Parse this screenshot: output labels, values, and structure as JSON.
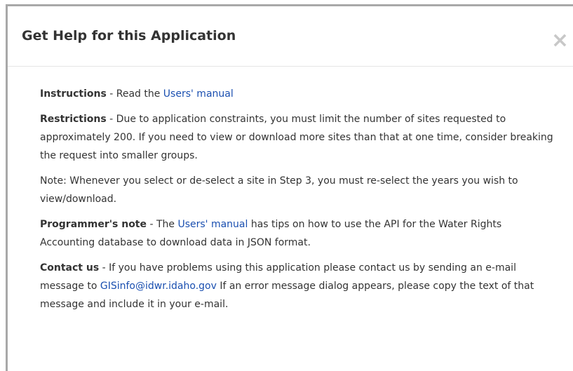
{
  "dialog": {
    "title": "Get Help for this Application",
    "close_label": "×"
  },
  "instructions": {
    "heading": "Instructions",
    "text": " - Read the ",
    "link": "Users' manual"
  },
  "restrictions": {
    "heading": "Restrictions",
    "text": " - Due to application constraints, you must limit the number of sites requested to approximately 200. If you need to view or download more sites than that at one time, consider breaking the request into smaller groups."
  },
  "note": {
    "text": "Note: Whenever you select or de-select a site in Step 3, you must re-select the years you wish to view/download."
  },
  "programmer_note": {
    "heading": "Programmer's note",
    "text_before": " - The ",
    "link": "Users' manual",
    "text_after": " has tips on how to use the API for the Water Rights Accounting database to download data in JSON format."
  },
  "contact": {
    "heading": "Contact us",
    "text_before": " - If you have problems using this application please contact us by sending an e-mail message to ",
    "email": "GISinfo@idwr.idaho.gov",
    "text_after": " If an error message dialog appears, please copy the text of that message and include it in your e-mail."
  }
}
